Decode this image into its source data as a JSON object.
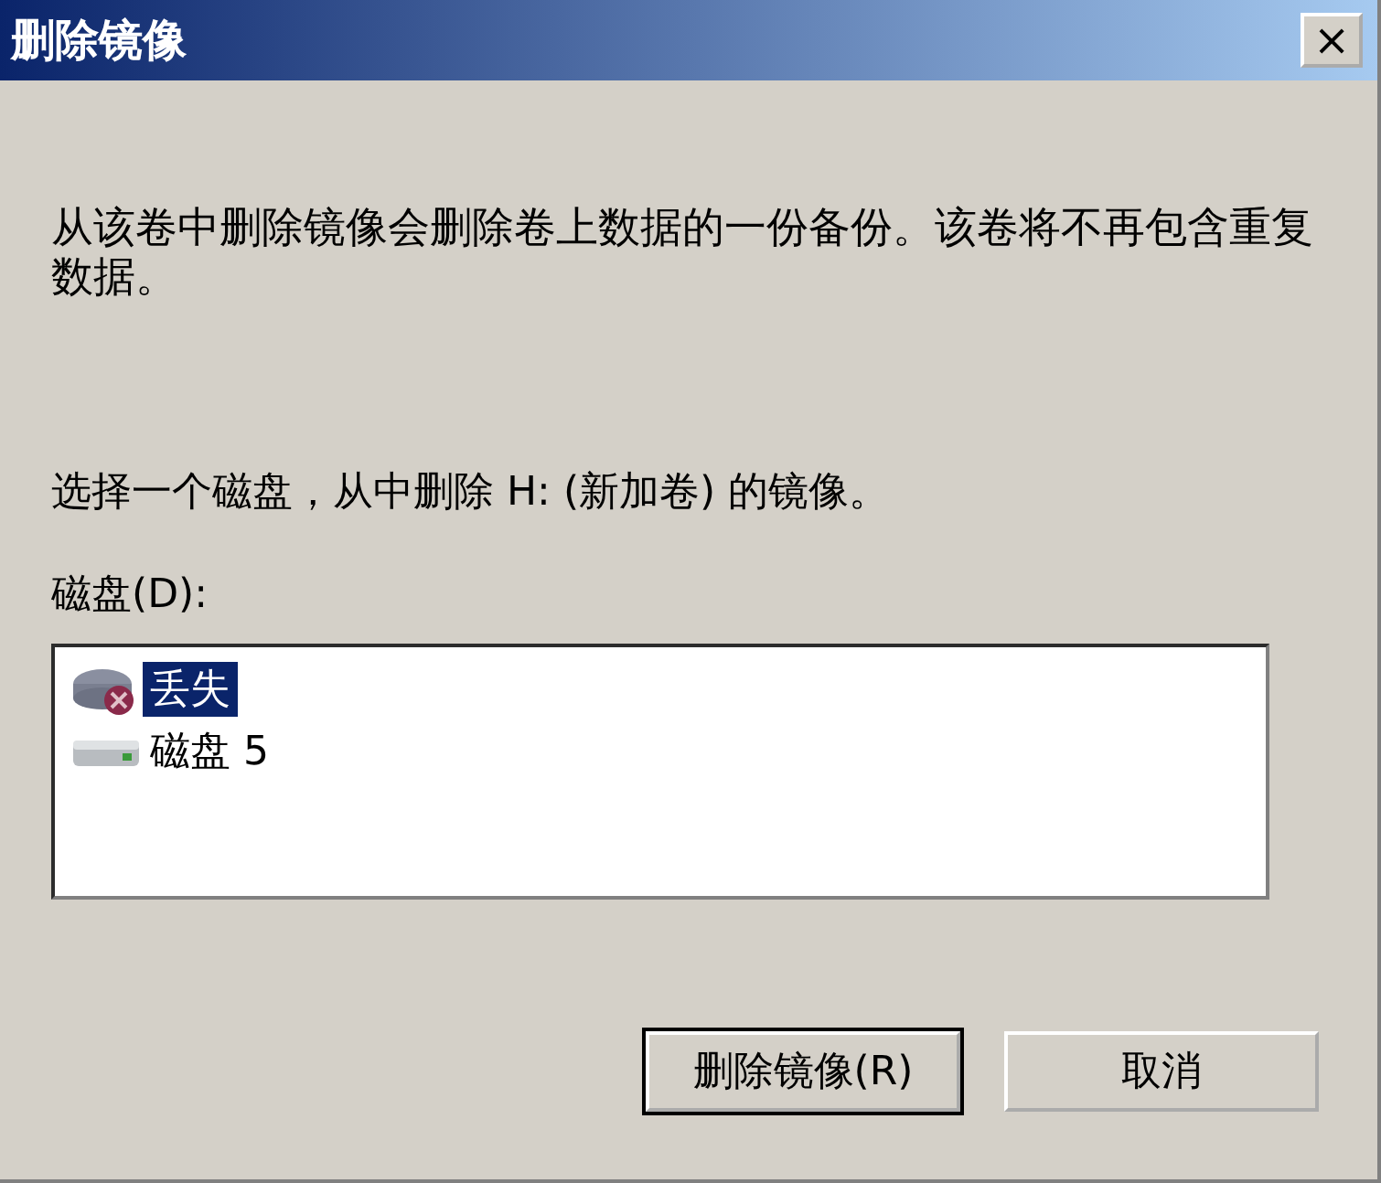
{
  "window": {
    "title": "删除镜像",
    "close": "×"
  },
  "message": "从该卷中删除镜像会删除卷上数据的一份备份。该卷将不再包含重复数据。",
  "prompt": "选择一个磁盘，从中删除 H: (新加卷) 的镜像。",
  "list_label": "磁盘(D):",
  "disks": [
    {
      "kind": "missing",
      "label": "丢失",
      "selected": true
    },
    {
      "kind": "disk",
      "label": "磁盘 5",
      "selected": false
    }
  ],
  "buttons": [
    {
      "label": "删除镜像(R)",
      "default": true
    },
    {
      "label": "取消",
      "default": false
    }
  ]
}
